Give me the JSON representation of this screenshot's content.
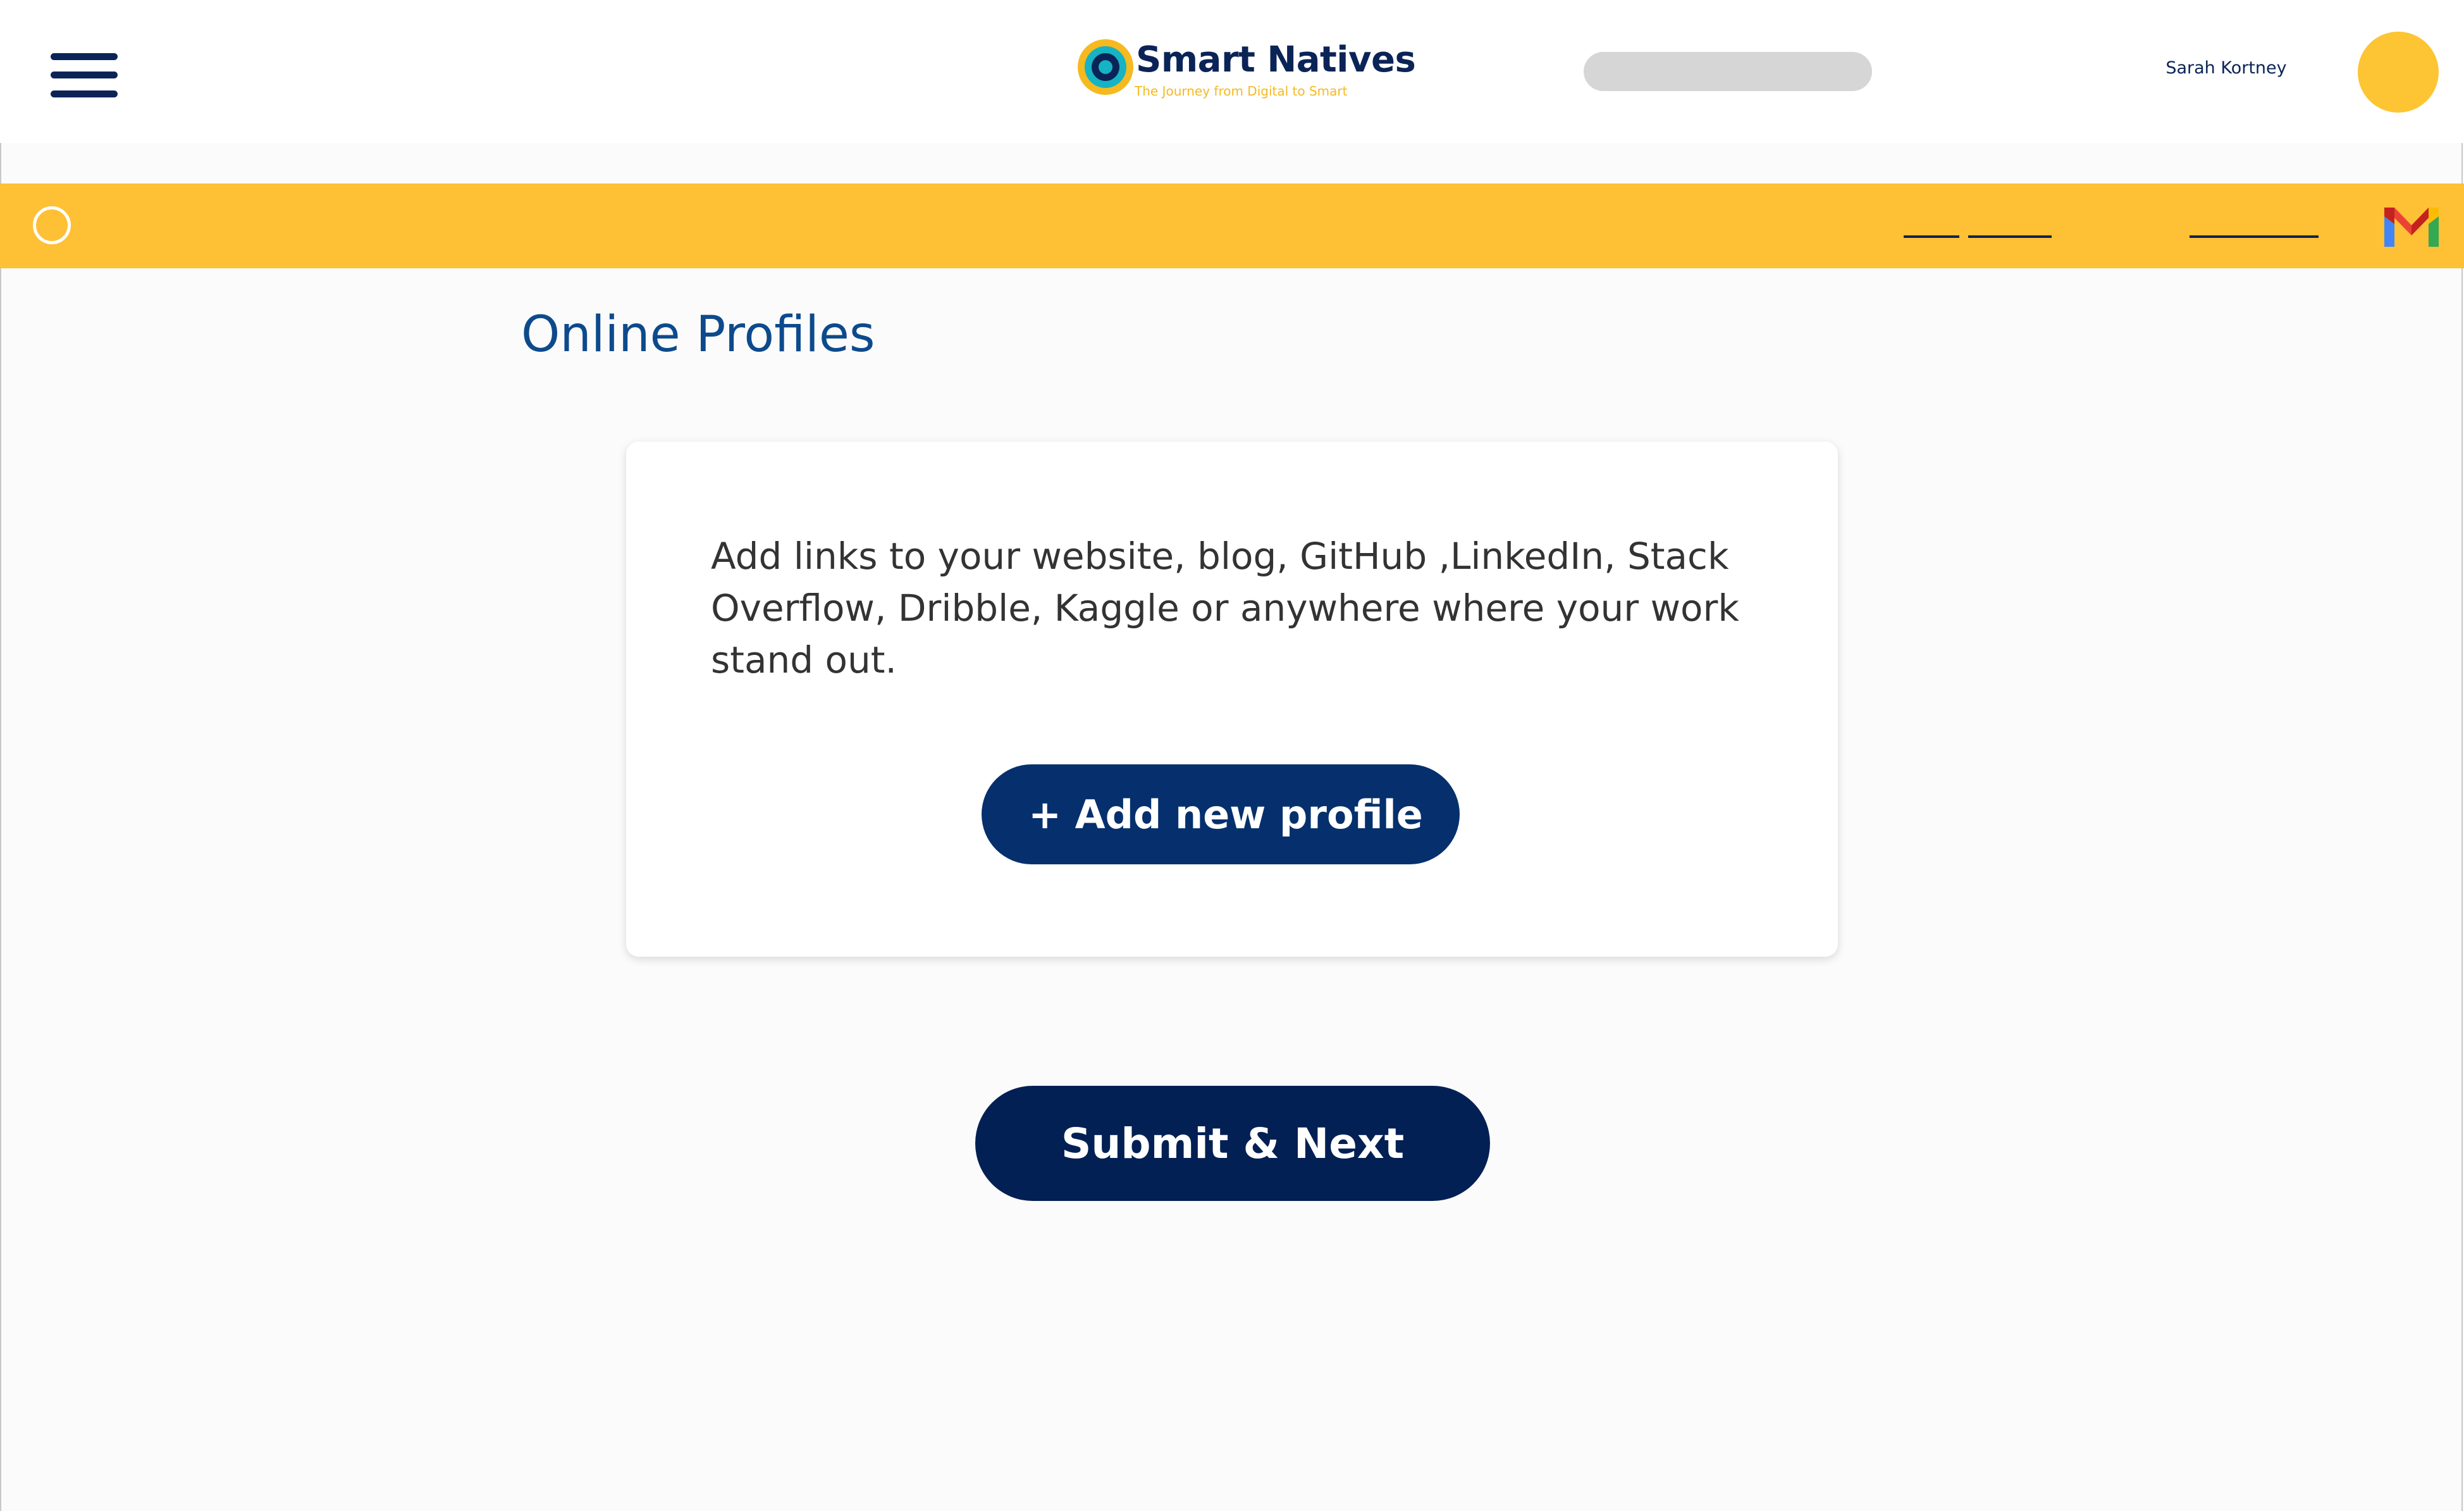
{
  "header": {
    "menu_icon": "hamburger-menu-icon",
    "logo": {
      "name": "Smart Natives",
      "tagline": "The Journey from Digital to Smart"
    },
    "user": {
      "name": "Sarah Kortney"
    }
  },
  "banner": {
    "color": "#fec035",
    "left_icon": "circle-icon",
    "right_icon": "gmail-icon"
  },
  "main": {
    "title": "Online Profiles",
    "card": {
      "description": "Add links to your website, blog, GitHub ,LinkedIn, Stack Overflow, Dribble, Kaggle or anywhere where your work stand out.",
      "add_button_label": "+ Add new profile"
    },
    "submit_button_label": "Submit & Next"
  },
  "colors": {
    "primary_navy": "#0b2457",
    "accent_yellow": "#fec035",
    "title_blue": "#0d4a8c",
    "button_navy": "#05306d"
  }
}
